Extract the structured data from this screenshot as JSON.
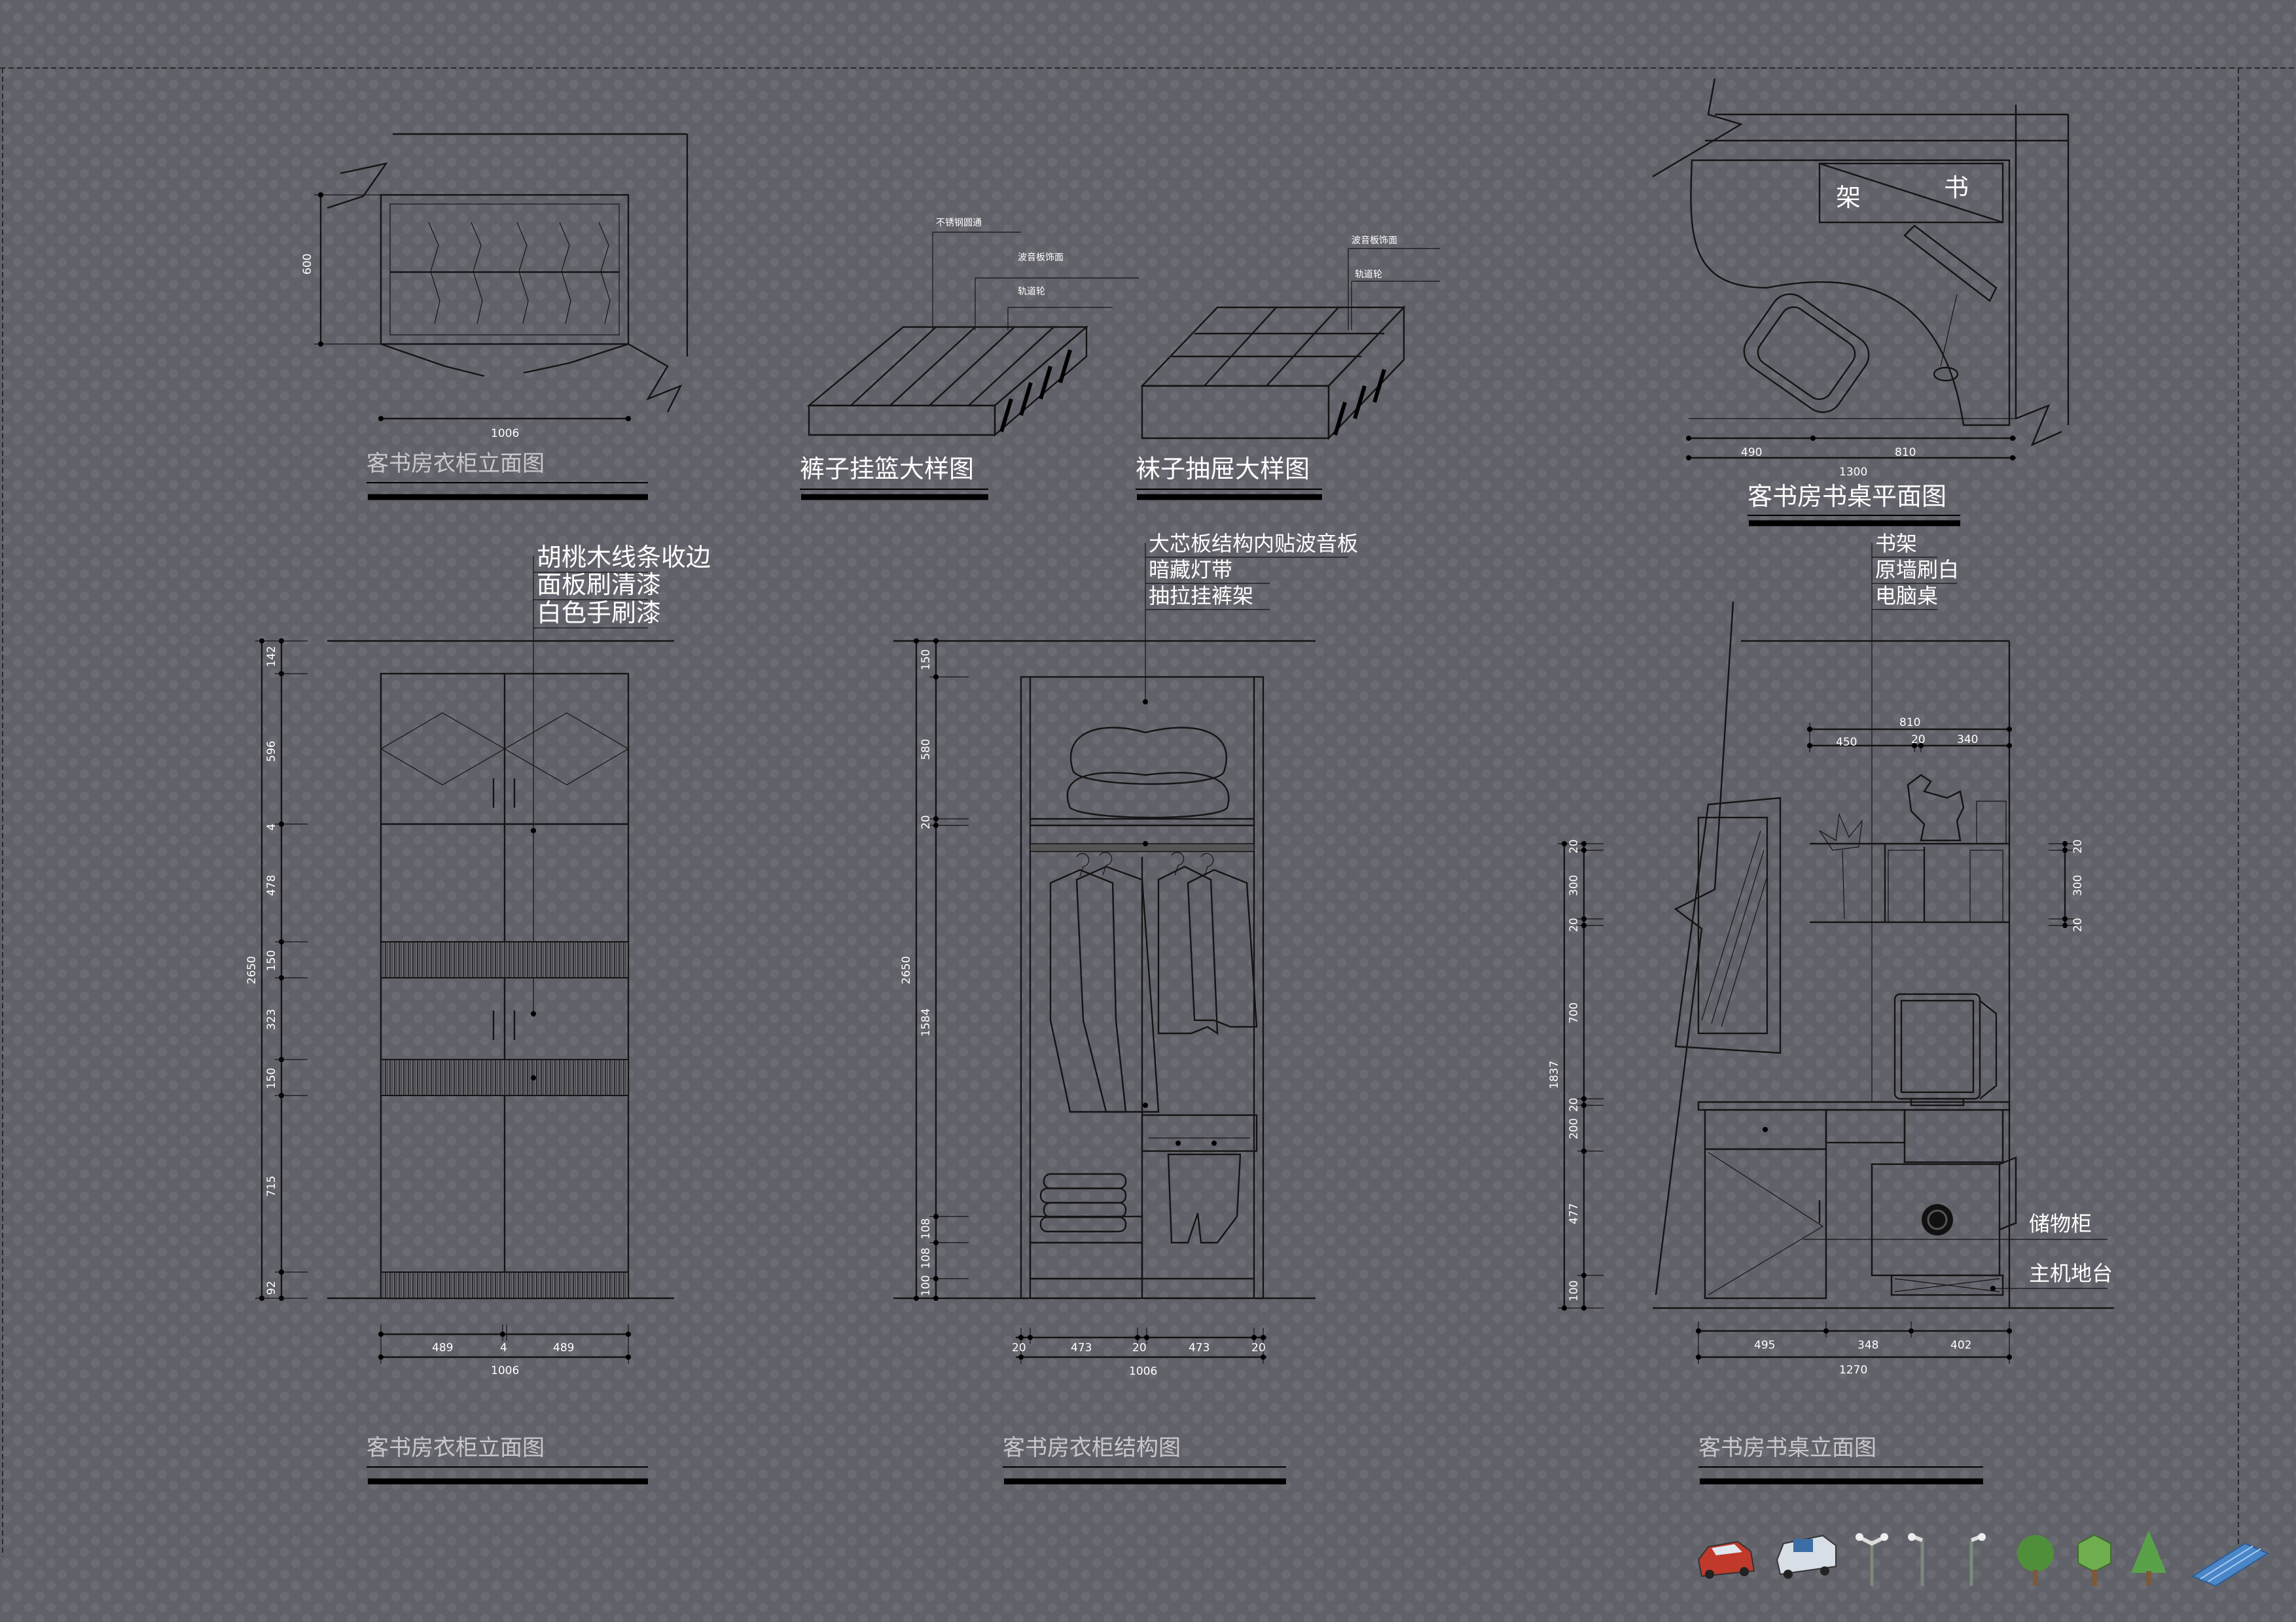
{
  "drawings": {
    "wardrobe_plan": {
      "title": "客书房衣柜立面图",
      "dims": {
        "width": "1006",
        "height": "600"
      }
    },
    "trouser_basket": {
      "title": "裤子挂篮大样图",
      "notes": [
        "不锈钢圆通",
        "波音板饰面",
        "轨道轮"
      ]
    },
    "sock_drawer": {
      "title": "袜子抽屉大样图",
      "notes": [
        "波音板饰面",
        "轨道轮"
      ]
    },
    "desk_plan": {
      "title": "客书房书桌平面图",
      "labels": [
        "书",
        "架"
      ],
      "dims": [
        "490",
        "810",
        "1300"
      ]
    },
    "wardrobe_elevation": {
      "title": "客书房衣柜立面图",
      "notes": [
        "胡桃木线条收边",
        "面板刷清漆",
        "白色手刷漆"
      ],
      "vdims": [
        "142",
        "596",
        "4",
        "478",
        "150",
        "323",
        "150",
        "715",
        "92"
      ],
      "total_height": "2650",
      "hdims": [
        "489",
        "4",
        "489"
      ],
      "total_width": "1006"
    },
    "wardrobe_structure": {
      "title": "客书房衣柜结构图",
      "notes": [
        "大芯板结构内贴波音板",
        "暗藏灯带",
        "抽拉挂裤架"
      ],
      "vdims": [
        "150",
        "580",
        "20",
        "1584",
        "108",
        "108",
        "100"
      ],
      "total_height": "2650",
      "hdims": [
        "20",
        "473",
        "20",
        "473",
        "20"
      ],
      "total_width": "1006"
    },
    "desk_elevation": {
      "title": "客书房书桌立面图",
      "notes": [
        "书架",
        "原墙刷白",
        "电脑桌"
      ],
      "side_notes": [
        "储物柜",
        "主机地台"
      ],
      "top_dims": [
        "810",
        "450",
        "20",
        "340"
      ],
      "vdims": [
        "20",
        "300",
        "20",
        "700",
        "20",
        "200",
        "477",
        "100"
      ],
      "total_height": "1837",
      "right_dims": [
        "20",
        "300",
        "20"
      ],
      "hdims": [
        "495",
        "348",
        "402"
      ],
      "total_width": "1270"
    }
  },
  "toolbar": {
    "icons": [
      "car-icon",
      "van-icon",
      "street-lamp-icon",
      "street-lamp-icon",
      "street-lamp-icon",
      "round-tree-icon",
      "cube-tree-icon",
      "cone-tree-icon",
      "blue-panel-icon"
    ]
  }
}
